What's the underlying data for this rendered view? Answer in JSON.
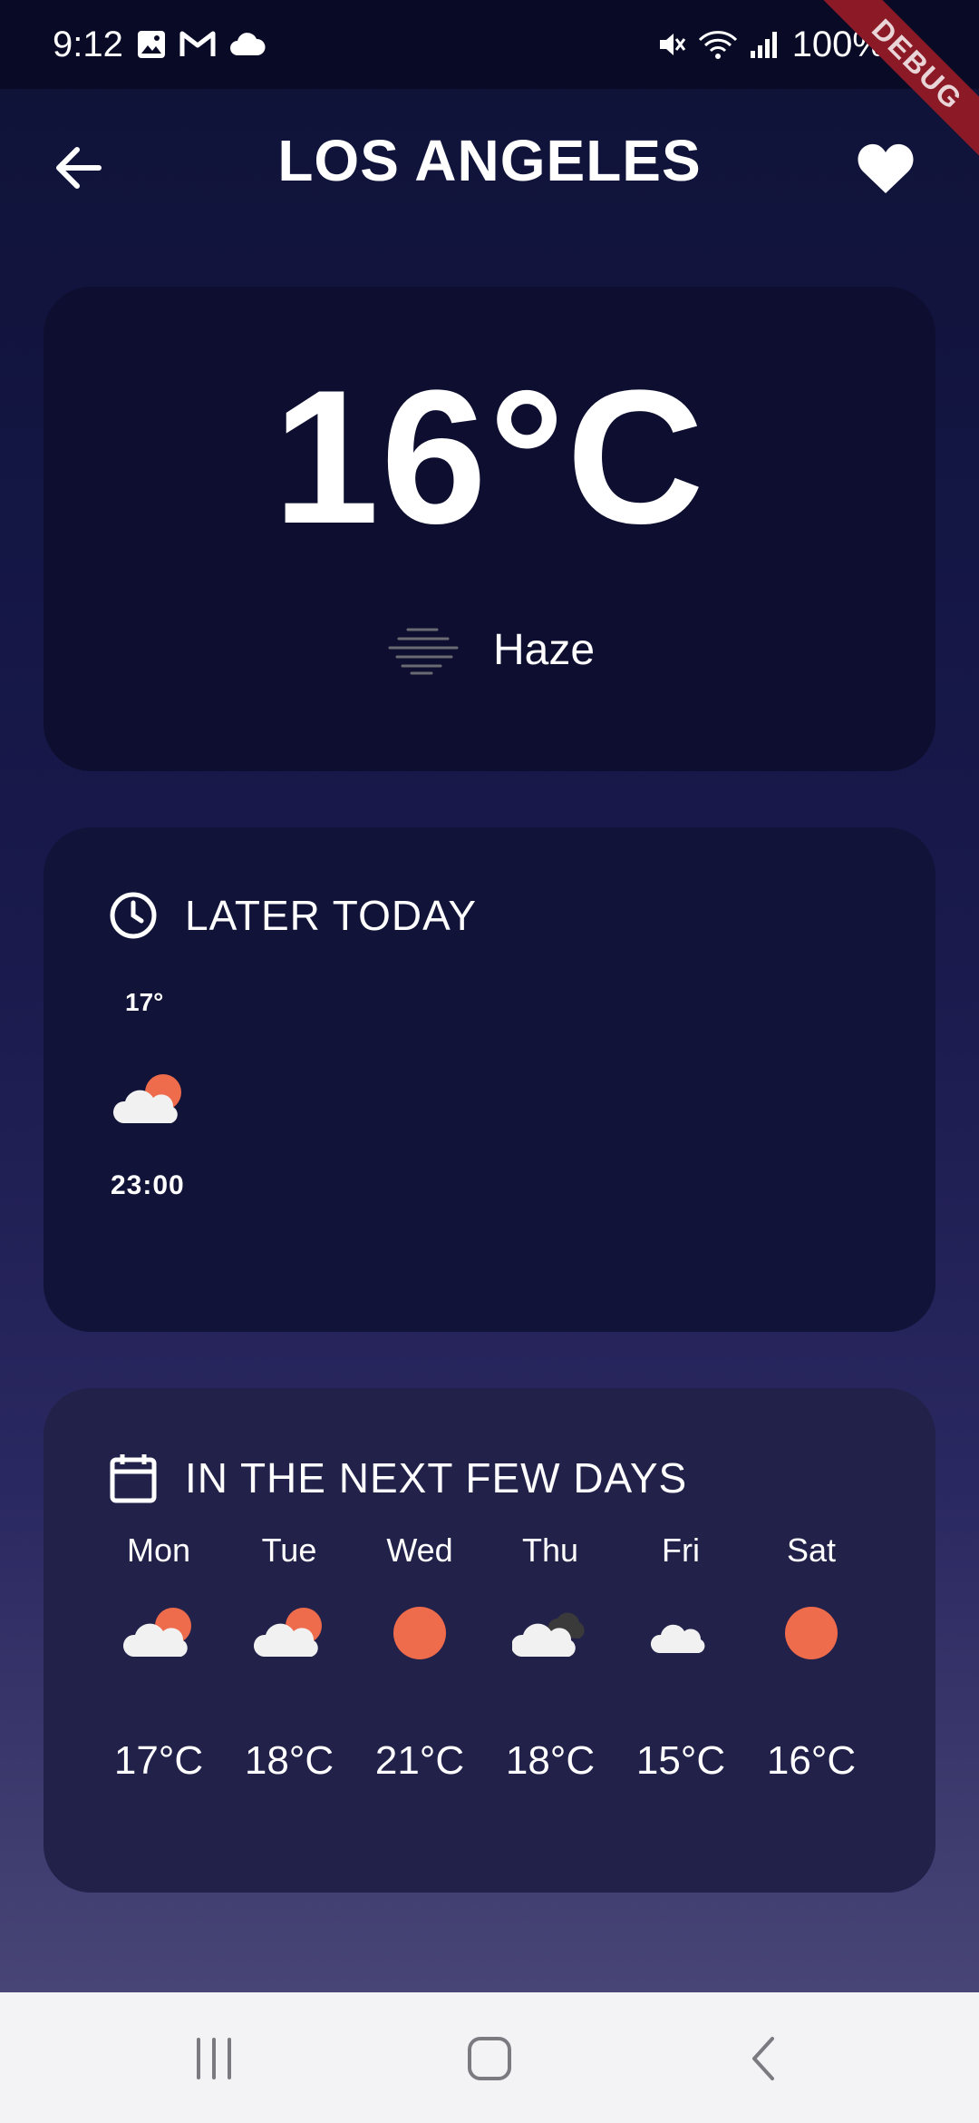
{
  "status_bar": {
    "time": "9:12",
    "battery": "100%",
    "left_icons": [
      "gallery-icon",
      "gmail-icon",
      "cloud-icon"
    ],
    "right_icons": [
      "mute-icon",
      "wifi-icon",
      "signal-icon",
      "battery-icon"
    ]
  },
  "debug_banner": "DEBUG",
  "app_bar": {
    "title": "LOS ANGELES",
    "back_icon": "arrow-left-icon",
    "favorite_icon": "heart-icon"
  },
  "current": {
    "temperature": "16°C",
    "condition": "Haze",
    "condition_icon": "haze-icon"
  },
  "later_today": {
    "title": "LATER TODAY",
    "icon": "clock-icon",
    "hours": [
      {
        "temp": "17°",
        "time": "23:00",
        "icon": "partly-cloudy-icon"
      }
    ]
  },
  "next_days": {
    "title": "IN THE NEXT FEW DAYS",
    "icon": "calendar-icon",
    "days": [
      {
        "day": "Mon",
        "temp": "17°C",
        "icon": "partly-cloudy-icon"
      },
      {
        "day": "Tue",
        "temp": "18°C",
        "icon": "partly-cloudy-icon"
      },
      {
        "day": "Wed",
        "temp": "21°C",
        "icon": "sun-icon"
      },
      {
        "day": "Thu",
        "temp": "18°C",
        "icon": "cloudy-icon"
      },
      {
        "day": "Fri",
        "temp": "15°C",
        "icon": "cloud-icon"
      },
      {
        "day": "Sat",
        "temp": "16°C",
        "icon": "sun-icon"
      }
    ]
  },
  "colors": {
    "accent_sun": "#ee6b4b",
    "cloud": "#f1f1f1",
    "dark_cloud": "#3a3a3a",
    "debug_ribbon": "#8b1a26"
  },
  "nav_bar": {
    "buttons": [
      "recent-apps-icon",
      "home-icon",
      "back-icon"
    ]
  }
}
